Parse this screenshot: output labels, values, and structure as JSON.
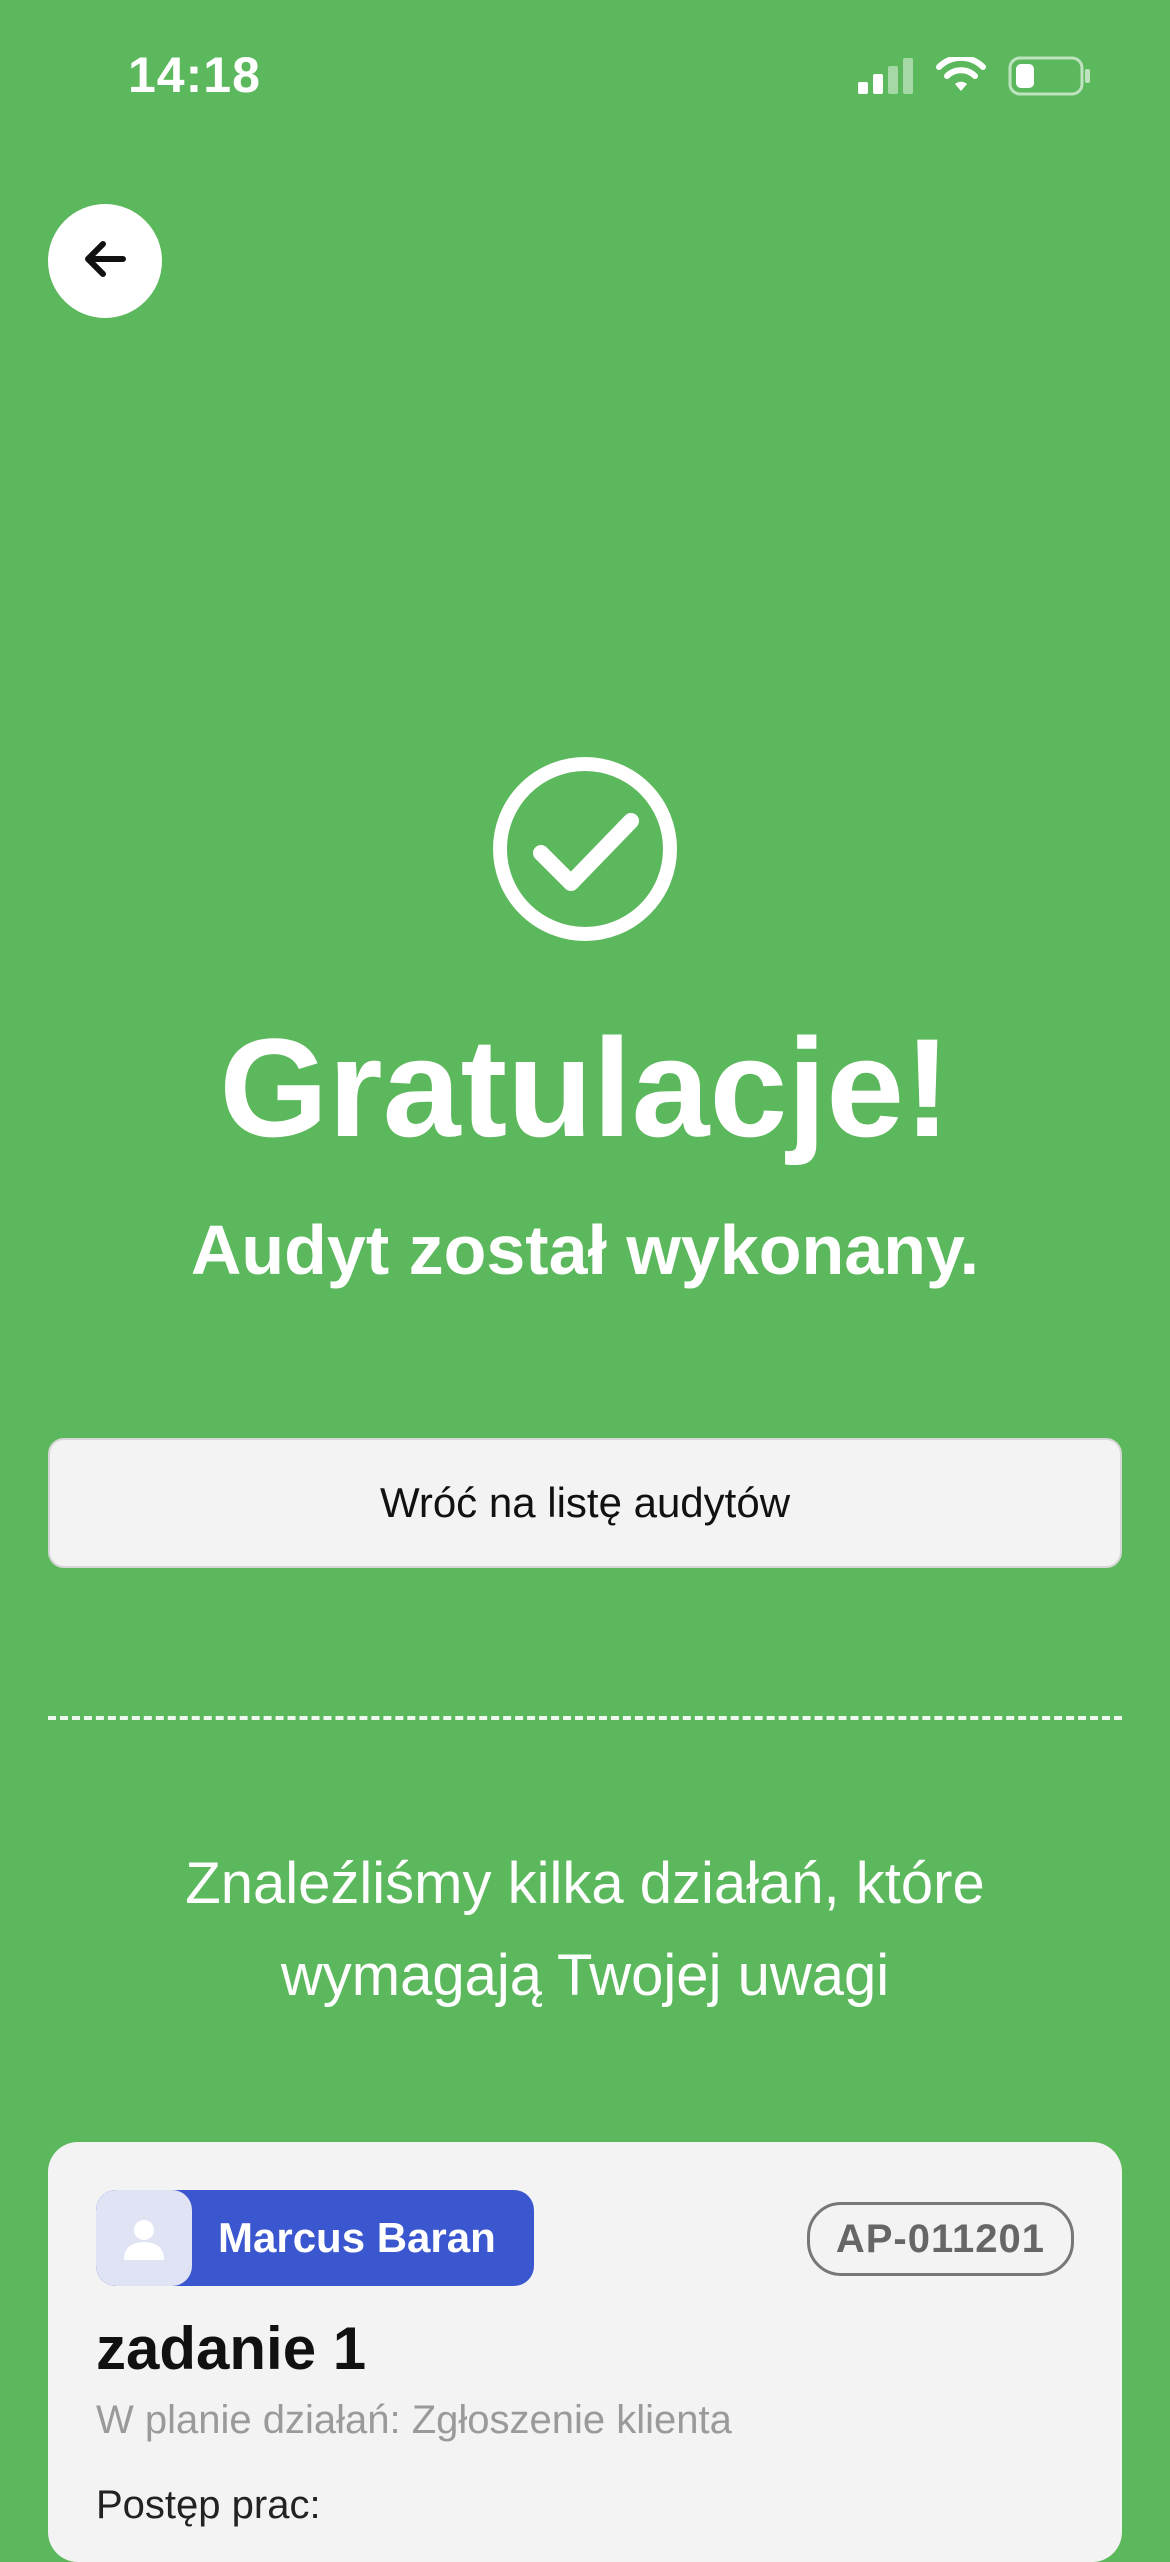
{
  "status_bar": {
    "time": "14:18",
    "icons": [
      "signal-icon",
      "wifi-icon",
      "battery-icon"
    ]
  },
  "navigation": {
    "back_icon": "arrow-left-icon"
  },
  "success": {
    "icon": "check-circle-icon",
    "title": "Gratulacje!",
    "subtitle": "Audyt został wykonany."
  },
  "actions": {
    "back_to_list_label": "Wróć na listę audytów"
  },
  "notice": {
    "text": "Znaleźliśmy kilka działań, które wymagają Twojej uwagi"
  },
  "card": {
    "assignee": "Marcus Baran",
    "assignee_icon": "user-avatar-icon",
    "id": "AP-011201",
    "title": "zadanie 1",
    "plan": "W planie działań: Zgłoszenie klienta",
    "progress_label": "Postęp prac:"
  },
  "colors": {
    "background": "#5cb85c",
    "assignee_chip": "#3b57d0",
    "card": "#f3f3f3"
  }
}
